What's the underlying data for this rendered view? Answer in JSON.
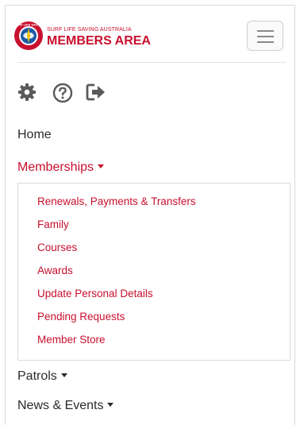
{
  "header": {
    "logo_small": "SURF LIFE SAVING AUSTRALIA",
    "logo_big": "MEMBERS AREA",
    "emblem_text": "SURF LIFE SAVING"
  },
  "icons": [
    "gear-icon",
    "question-circle-icon",
    "sign-out-icon"
  ],
  "nav": {
    "home": "Home",
    "memberships": "Memberships",
    "patrols": "Patrols",
    "news_events": "News & Events"
  },
  "dropdown": {
    "items": [
      "Renewals, Payments & Transfers",
      "Family",
      "Courses",
      "Awards",
      "Update Personal Details",
      "Pending Requests",
      "Member Store"
    ]
  },
  "colors": {
    "brand_red": "#c8102e",
    "brand_blue": "#1f5aa6",
    "icon_gray": "#5a5a5a"
  }
}
